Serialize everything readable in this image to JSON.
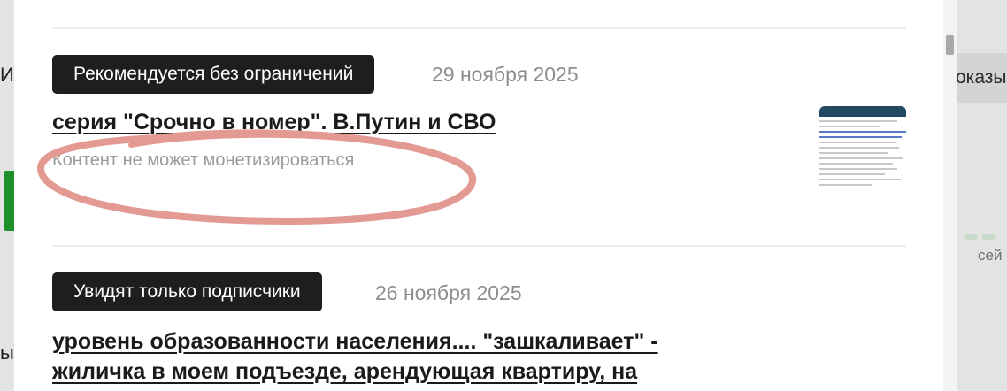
{
  "background": {
    "left_text_top": "Ин",
    "left_text_bottom": "ы",
    "right_text": "оказы",
    "right_text_small": "сей"
  },
  "modal": {
    "items": [
      {
        "badge": "Рекомендуется без ограничений",
        "date": "29 ноября 2025",
        "title": "серия \"Срочно в номер\". В.Путин и СВО",
        "subtitle": "Контент не может монетизироваться",
        "thumbnail_icon": "article-thumbnail-icon"
      },
      {
        "badge": "Увидят только подписчики",
        "date": "26 ноября 2025",
        "title_line1": "уровень образованности населения.... \"зашкаливает\" -",
        "title_line2": "жиличка в моем подъезде, арендующая квартиру, на"
      }
    ]
  },
  "colors": {
    "badge_bg": "#1e1e1e",
    "annotation_stroke": "#e39a93",
    "date_text": "#8d8d8d",
    "thumbnail_highlight": "#5779c6"
  }
}
